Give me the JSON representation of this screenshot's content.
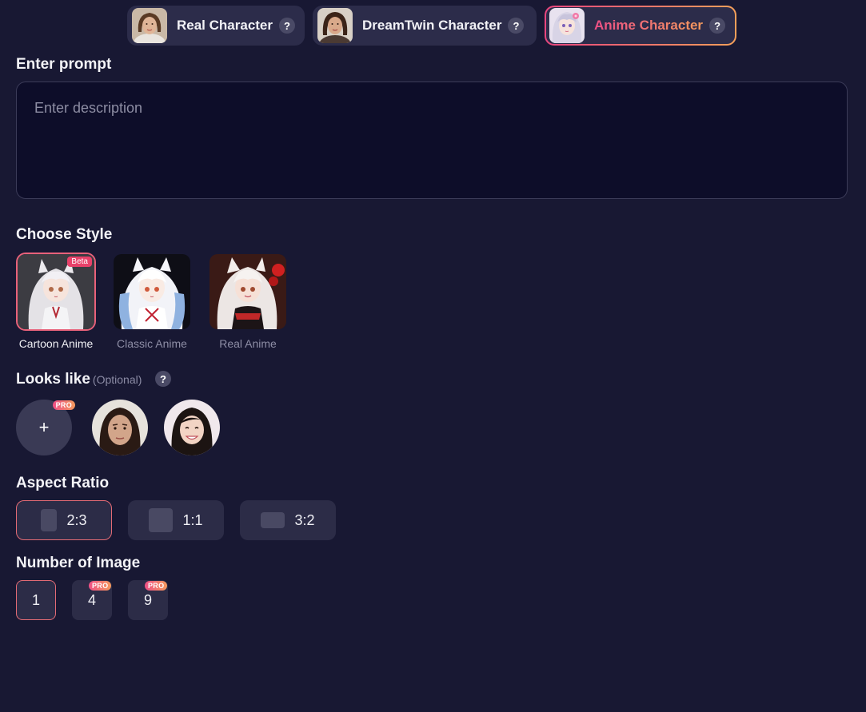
{
  "tabs": [
    {
      "label": "Real Character",
      "help": "?",
      "active": false
    },
    {
      "label": "DreamTwin Character",
      "help": "?",
      "active": false
    },
    {
      "label": "Anime Character",
      "help": "?",
      "active": true
    }
  ],
  "prompt": {
    "heading": "Enter prompt",
    "placeholder": "Enter description",
    "value": ""
  },
  "style": {
    "heading": "Choose Style",
    "items": [
      {
        "label": "Cartoon Anime",
        "badge": "Beta",
        "active": true
      },
      {
        "label": "Classic Anime",
        "active": false
      },
      {
        "label": "Real Anime",
        "active": false
      }
    ]
  },
  "looks_like": {
    "heading": "Looks like",
    "optional": "(Optional)",
    "help": "?",
    "add": "+",
    "pro": "PRO"
  },
  "aspect_ratio": {
    "heading": "Aspect Ratio",
    "options": [
      {
        "label": "2:3",
        "active": true
      },
      {
        "label": "1:1",
        "active": false
      },
      {
        "label": "3:2",
        "active": false
      }
    ]
  },
  "number_of_image": {
    "heading": "Number of Image",
    "options": [
      {
        "label": "1",
        "active": true
      },
      {
        "label": "4",
        "pro": "PRO"
      },
      {
        "label": "9",
        "pro": "PRO"
      }
    ]
  },
  "colors": {
    "background": "#181833",
    "accent_start": "#ee4f86",
    "accent_end": "#f49a5d"
  }
}
